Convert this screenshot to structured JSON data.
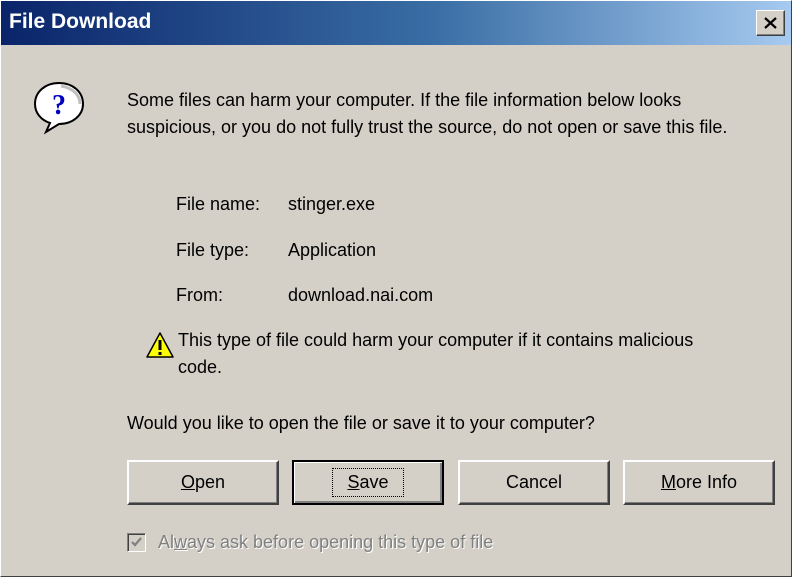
{
  "window": {
    "title": "File Download",
    "close_glyph": "✕"
  },
  "intro_text": "Some files can harm your computer. If the file information below looks suspicious, or you do not fully trust the source, do not open or save this file.",
  "file_info": {
    "name_label": "File name:",
    "name_value": "stinger.exe",
    "type_label": "File type:",
    "type_value": "Application",
    "from_label": "From:",
    "from_value": "download.nai.com"
  },
  "warning_text": "This type of file could harm your computer if it contains malicious code.",
  "question_text": "Would you like to open the file or save it to your computer?",
  "buttons": {
    "open": {
      "mnemonic": "O",
      "rest": "pen"
    },
    "save": {
      "mnemonic": "S",
      "rest": "ave"
    },
    "cancel": {
      "label": "Cancel"
    },
    "more_info": {
      "mnemonic": "M",
      "rest": "ore Info"
    }
  },
  "checkbox": {
    "prefix": "Al",
    "mnemonic": "w",
    "rest": "ays ask before opening this type of file",
    "checked": true,
    "disabled": true
  },
  "icons": {
    "question": "question-icon",
    "warning": "warning-icon",
    "close": "close-icon"
  }
}
